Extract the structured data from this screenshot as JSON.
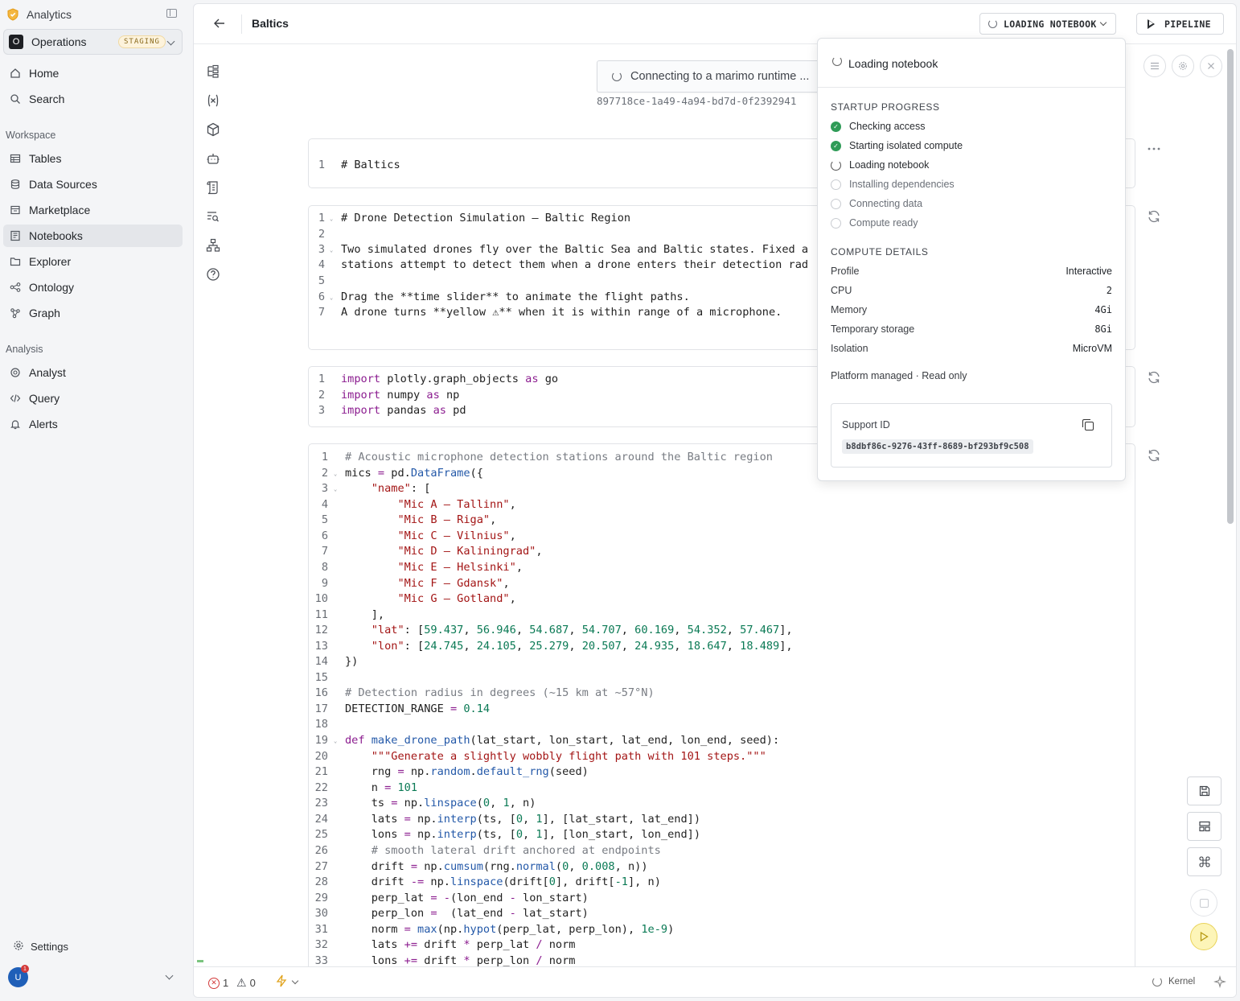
{
  "sidebar": {
    "app_title": "Analytics",
    "org": {
      "initial": "O",
      "name": "Operations",
      "env_badge": "STAGING"
    },
    "primary_items": [
      {
        "label": "Home",
        "icon": "home-icon"
      },
      {
        "label": "Search",
        "icon": "search-icon"
      }
    ],
    "workspace_label": "Workspace",
    "workspace_items": [
      {
        "label": "Tables",
        "icon": "table-icon"
      },
      {
        "label": "Data Sources",
        "icon": "database-icon"
      },
      {
        "label": "Marketplace",
        "icon": "store-icon"
      },
      {
        "label": "Notebooks",
        "icon": "notebook-icon",
        "active": true
      },
      {
        "label": "Explorer",
        "icon": "folder-icon"
      },
      {
        "label": "Ontology",
        "icon": "ontology-icon"
      },
      {
        "label": "Graph",
        "icon": "graph-icon"
      }
    ],
    "analysis_label": "Analysis",
    "analysis_items": [
      {
        "label": "Analyst",
        "icon": "analyst-icon"
      },
      {
        "label": "Query",
        "icon": "code-icon"
      },
      {
        "label": "Alerts",
        "icon": "bell-icon"
      }
    ],
    "settings_label": "Settings",
    "user": {
      "initial": "U",
      "notifications": "1"
    }
  },
  "header": {
    "title": "Baltics",
    "loading_button": "LOADING NOTEBOOK",
    "pipeline_button": "PIPELINE"
  },
  "runtime": {
    "connecting_text": "Connecting to a marimo runtime ...",
    "session_id": "897718ce-1a49-4a94-bd7d-0f2392941"
  },
  "cells": {
    "cell1": [
      "# Baltics"
    ],
    "cell2": [
      "# Drone Detection Simulation — Baltic Region",
      "",
      "Two simulated drones fly over the Baltic Sea and Baltic states. Fixed a",
      "stations attempt to detect them when a drone enters their detection rad",
      "",
      "Drag the **time slider** to animate the flight paths.",
      "A drone turns **yellow ⚠** when it is within range of a microphone."
    ],
    "cell3": [
      "import plotly.graph_objects as go",
      "import numpy as np",
      "import pandas as pd"
    ]
  },
  "popover": {
    "title": "Loading notebook",
    "startup_label": "STARTUP PROGRESS",
    "steps": [
      {
        "label": "Checking access",
        "state": "done"
      },
      {
        "label": "Starting isolated compute",
        "state": "done"
      },
      {
        "label": "Loading notebook",
        "state": "active"
      },
      {
        "label": "Installing dependencies",
        "state": "pending"
      },
      {
        "label": "Connecting data",
        "state": "pending"
      },
      {
        "label": "Compute ready",
        "state": "pending"
      }
    ],
    "compute_label": "COMPUTE DETAILS",
    "details": [
      {
        "key": "Profile",
        "value": "Interactive"
      },
      {
        "key": "CPU",
        "value": "2"
      },
      {
        "key": "Memory",
        "value": "4Gi"
      },
      {
        "key": "Temporary storage",
        "value": "8Gi"
      },
      {
        "key": "Isolation",
        "value": "MicroVM"
      }
    ],
    "platform_note": "Platform managed · Read only",
    "support_label": "Support ID",
    "support_id": "b8dbf86c-9276-43ff-8689-bf293bf9c508"
  },
  "statusbar": {
    "errors": "1",
    "warnings": "0",
    "kernel_label": "Kernel"
  },
  "colors": {
    "accent_yellow": "#fdf5b8",
    "success": "#2f9b57",
    "error": "#d33a3a"
  }
}
